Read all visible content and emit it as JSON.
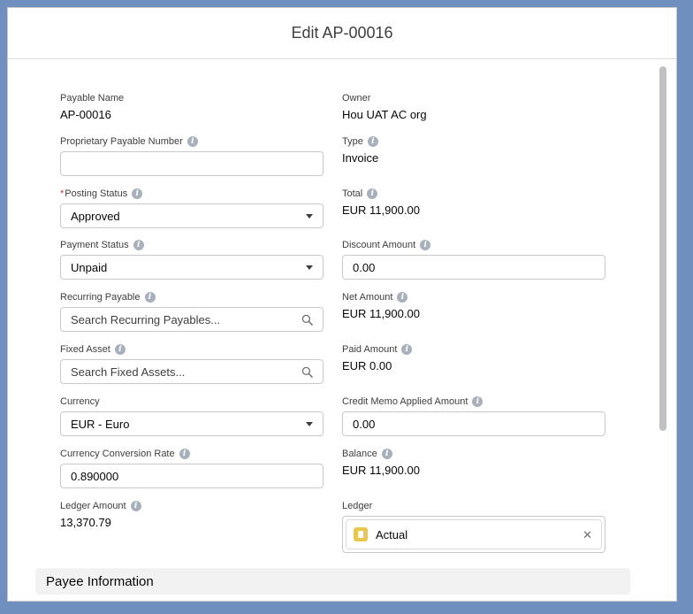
{
  "modal": {
    "title": "Edit AP-00016"
  },
  "left_fields": {
    "payable_name": {
      "label": "Payable Name",
      "value": "AP-00016"
    },
    "proprietary_payable_number": {
      "label": "Proprietary Payable Number",
      "value": ""
    },
    "posting_status": {
      "label": "Posting Status",
      "required_mark": "*",
      "value": "Approved"
    },
    "payment_status": {
      "label": "Payment Status",
      "value": "Unpaid"
    },
    "recurring_payable": {
      "label": "Recurring Payable",
      "placeholder": "Search Recurring Payables..."
    },
    "fixed_asset": {
      "label": "Fixed Asset",
      "placeholder": "Search Fixed Assets..."
    },
    "currency": {
      "label": "Currency",
      "value": "EUR - Euro"
    },
    "currency_conversion_rate": {
      "label": "Currency Conversion Rate",
      "value": "0.890000"
    },
    "ledger_amount": {
      "label": "Ledger Amount",
      "value": "13,370.79"
    }
  },
  "right_fields": {
    "owner": {
      "label": "Owner",
      "value": "Hou UAT AC org"
    },
    "type": {
      "label": "Type",
      "value": "Invoice"
    },
    "total": {
      "label": "Total",
      "value": "EUR 11,900.00"
    },
    "discount_amount": {
      "label": "Discount Amount",
      "value": "0.00"
    },
    "net_amount": {
      "label": "Net Amount",
      "value": "EUR 11,900.00"
    },
    "paid_amount": {
      "label": "Paid Amount",
      "value": "EUR 0.00"
    },
    "credit_memo_applied_amount": {
      "label": "Credit Memo Applied Amount",
      "value": "0.00"
    },
    "balance": {
      "label": "Balance",
      "value": "EUR 11,900.00"
    },
    "ledger": {
      "label": "Ledger",
      "value": "Actual"
    }
  },
  "sections": {
    "payee_information": "Payee Information"
  },
  "icons": {
    "info": "info-icon",
    "search": "search-icon",
    "dropdown": "chevron-down-icon",
    "ledger": "ledger-icon",
    "close": "close-icon"
  },
  "colors": {
    "backdrop": "#6f8fbf",
    "required": "#c23934",
    "ledger_icon": "#e8c84a"
  }
}
